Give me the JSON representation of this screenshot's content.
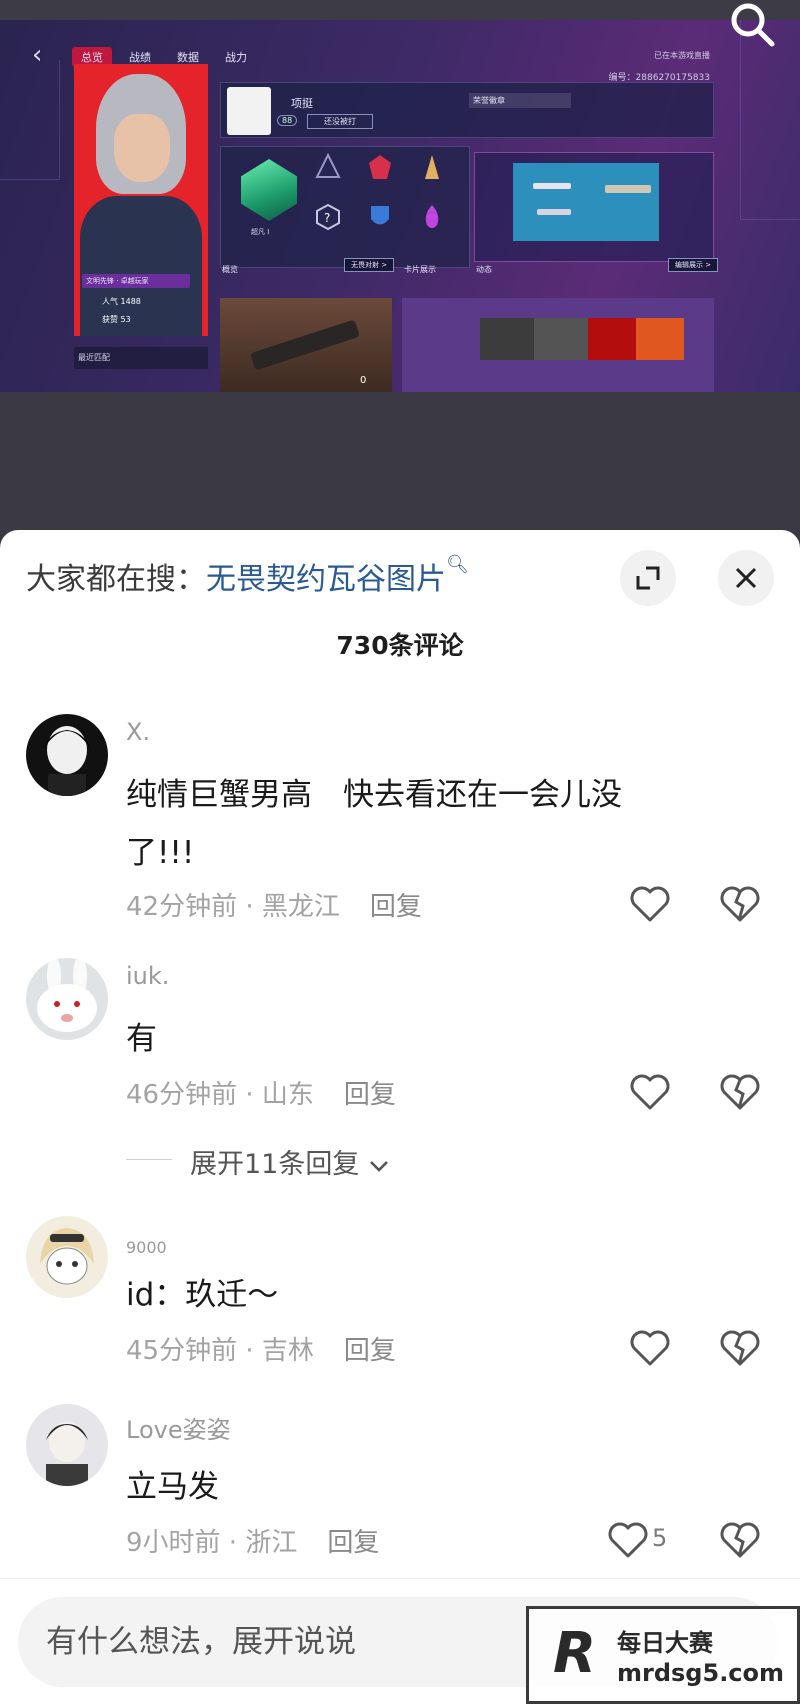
{
  "video": {
    "game_tabs": [
      "总览",
      "战绩",
      "数据",
      "战力"
    ],
    "game_status": "已在本游戏直播",
    "game_id": "编号：2886270175833",
    "player_name": "项挺",
    "player_level": "88",
    "player_status": "还没被打",
    "player_tag": "荣誉徽章",
    "rank_label": "超凡 I",
    "recent_label": "最近匹配",
    "section_overview": "概览",
    "section_overview_btn": "无畏对射 >",
    "section_showcase": "卡片展示",
    "section_dynamics": "动态",
    "section_edit_btn": "编辑展示 >",
    "agent_popularity": "人气 1488",
    "agent_likes": "获赞 53",
    "agent_badge": "文明先锋 · 卓越玩家",
    "scene_likes": "0",
    "swatch_colors": [
      "#3c3c3c",
      "#545454",
      "#b30d0d",
      "#e0571f"
    ]
  },
  "sheet": {
    "search_prefix": "大家都在搜：",
    "search_term": "无畏契约瓦谷图片",
    "comment_count": "730条评论",
    "reply_label": "回复",
    "expand_label": "展开11条回复"
  },
  "comments": [
    {
      "user": "X.",
      "lines": [
        "纯情巨蟹男高　快去看还在一会儿没",
        "了!!!"
      ],
      "time": "42分钟前",
      "location": "黑龙江",
      "likes": ""
    },
    {
      "user": "iuk.",
      "lines": [
        "有"
      ],
      "time": "46分钟前",
      "location": "山东",
      "likes": ""
    },
    {
      "user": "9000",
      "lines": [
        "id：玖迁～"
      ],
      "time": "45分钟前",
      "location": "吉林",
      "likes": ""
    },
    {
      "user": "Love姿姿",
      "lines": [
        "立马发"
      ],
      "time": "9小时前",
      "location": "浙江",
      "likes": "5"
    }
  ],
  "input": {
    "placeholder": "有什么想法，展开说说"
  },
  "watermark": {
    "logo_letter": "R",
    "title": "每日大赛",
    "url": "mrdsg5.com"
  }
}
